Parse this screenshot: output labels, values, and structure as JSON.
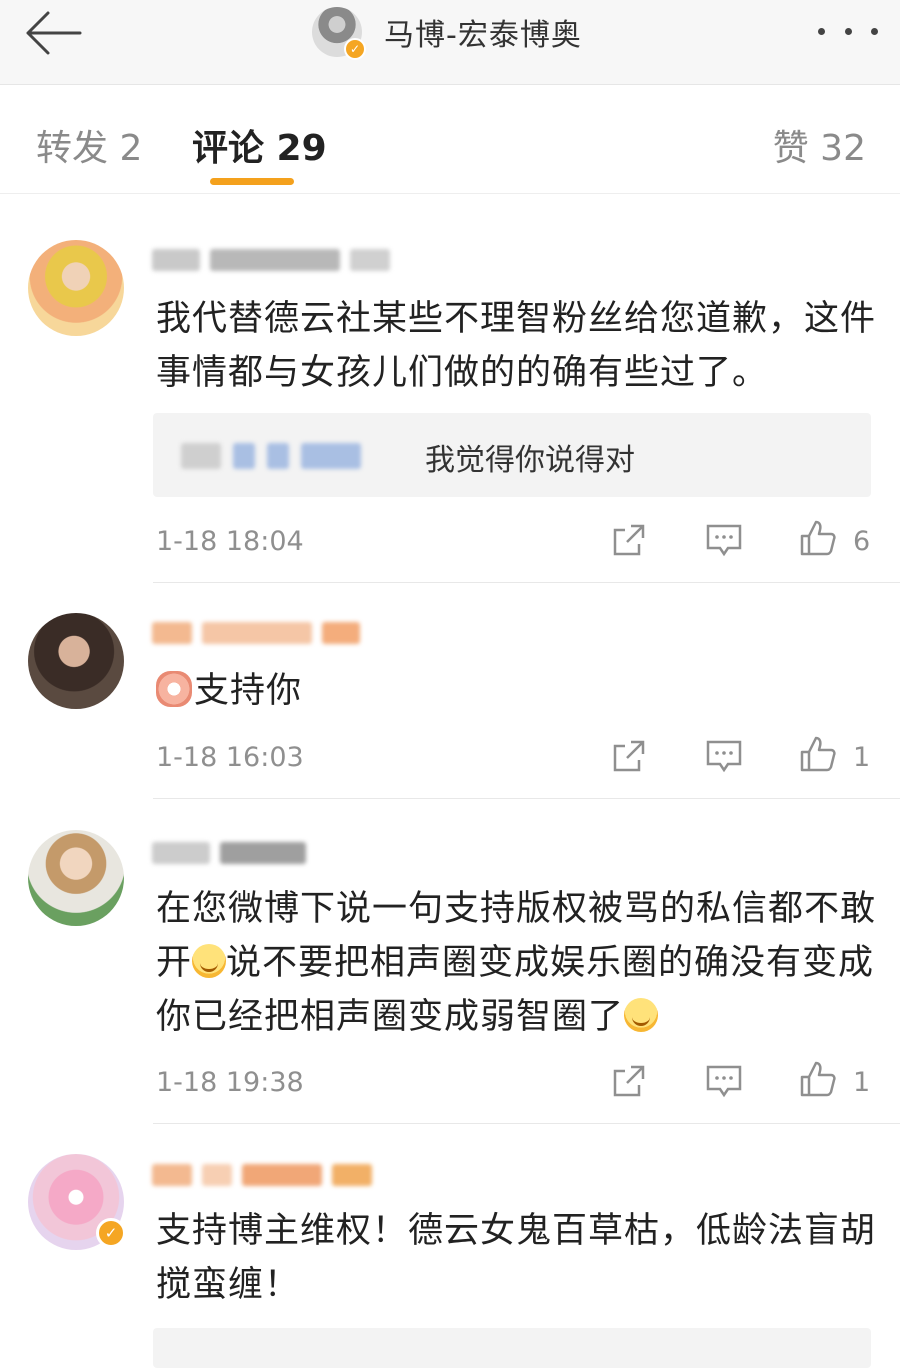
{
  "header": {
    "title": "马博-宏泰博奥",
    "back_icon": "arrow-left-icon",
    "more_icon": "more-dots-icon",
    "verified_badge": "✓"
  },
  "tabs": [
    {
      "label": "转发 2"
    },
    {
      "label": "评论 29"
    },
    {
      "label": "赞 32"
    }
  ],
  "accent_color": "#f4a11d",
  "comments": [
    {
      "text": "我代替德云社某些不理智粉丝给您道歉，这件事情都与女孩儿们做的的确有些过了。",
      "reply_text": "我觉得你说得对",
      "time": "1-18 18:04",
      "likes": "6"
    },
    {
      "text": "支持你",
      "time": "1-18 16:03",
      "likes": "1"
    },
    {
      "text_part1": "在您微博下说一句支持版权被骂的私信都不敢开",
      "text_part2": "说不要把相声圈变成娱乐圈的确没有变成你已经把相声圈变成弱智圈了",
      "time": "1-18 19:38",
      "likes": "1"
    },
    {
      "text": "支持博主维权！德云女鬼百草枯，低龄法盲胡搅蛮缠！",
      "verified_badge": "✓"
    }
  ]
}
